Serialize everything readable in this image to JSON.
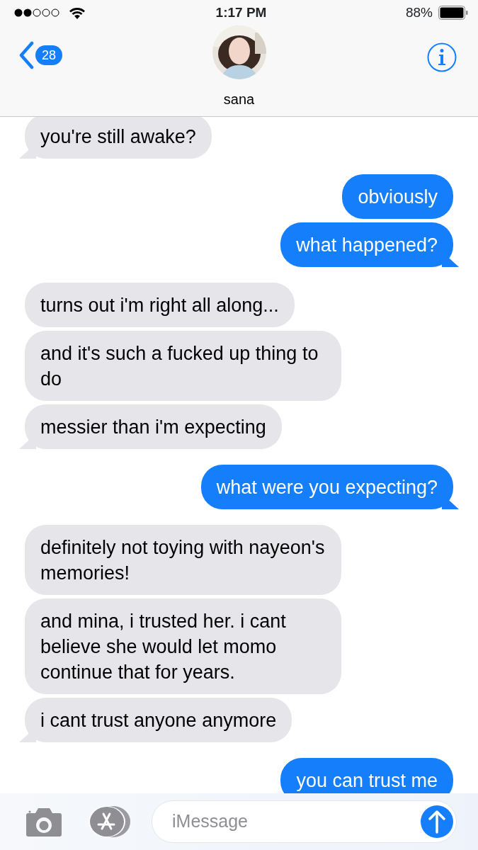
{
  "status_bar": {
    "time": "1:17 PM",
    "battery": "88%"
  },
  "header": {
    "back_count": "28",
    "contact_name": "sana"
  },
  "messages": [
    {
      "kind": "incoming",
      "text": "you're still awake?",
      "tail": true
    },
    {
      "kind": "outgoing",
      "text": "obviously",
      "tail": false
    },
    {
      "kind": "outgoing",
      "text": "what happened?",
      "tail": true
    },
    {
      "kind": "incoming",
      "text": "turns out i'm right all along...",
      "tail": false
    },
    {
      "kind": "incoming",
      "text": "and it's such a fucked up thing to do",
      "tail": false
    },
    {
      "kind": "incoming",
      "text": "messier than i'm expecting",
      "tail": true
    },
    {
      "kind": "outgoing",
      "text": "what were you expecting?",
      "tail": true
    },
    {
      "kind": "incoming",
      "text": "definitely not toying with nayeon's memories!",
      "tail": false
    },
    {
      "kind": "incoming",
      "text": "and mina, i trusted her. i cant believe she would let momo continue that for years.",
      "tail": false
    },
    {
      "kind": "incoming",
      "text": "i cant trust anyone anymore",
      "tail": true
    },
    {
      "kind": "outgoing",
      "text": "you can trust me"
    }
  ],
  "composer": {
    "placeholder": "iMessage"
  }
}
